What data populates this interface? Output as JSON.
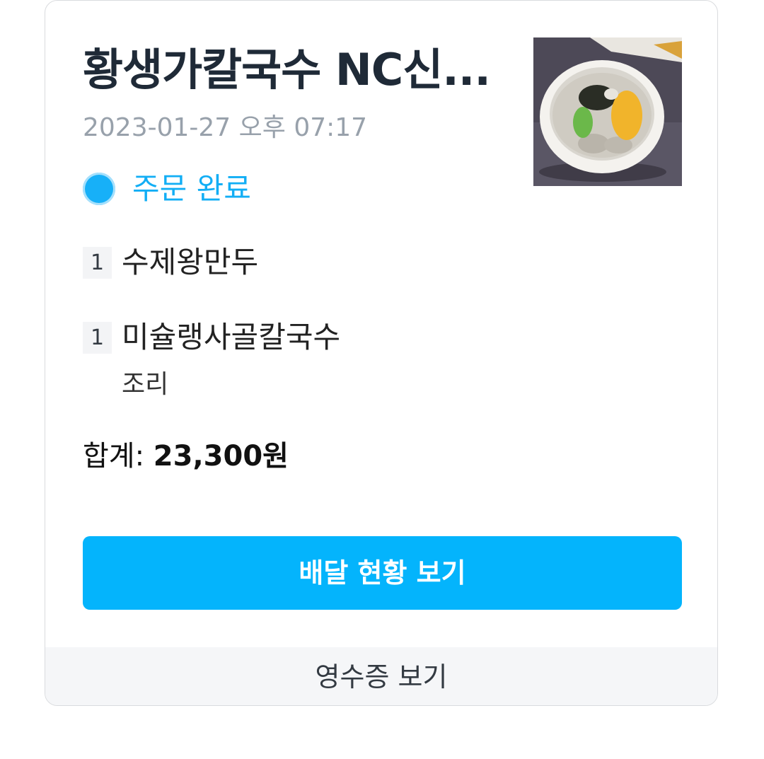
{
  "order": {
    "store_name": "황생가칼국수 NC신...",
    "datetime": "2023-01-27 오후 07:17",
    "status": "주문 완료",
    "status_color": "#12aef5",
    "items": [
      {
        "qty": "1",
        "name": "수제왕만두",
        "option": ""
      },
      {
        "qty": "1",
        "name": "미슐랭사골칼국수",
        "option": "조리"
      }
    ],
    "total_label": "합계:",
    "total_value": "23,300원"
  },
  "actions": {
    "delivery_status_label": "배달 현황 보기",
    "receipt_label": "영수증 보기",
    "accent_color": "#04b4fc"
  },
  "thumbnail": {
    "icon": "food-photo"
  }
}
